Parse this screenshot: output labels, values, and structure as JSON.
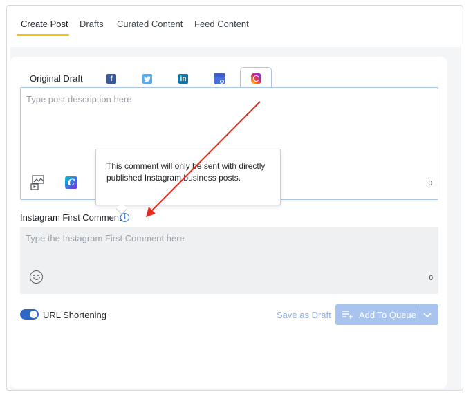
{
  "tabs": [
    {
      "label": "Create Post",
      "active": true
    },
    {
      "label": "Drafts",
      "active": false
    },
    {
      "label": "Curated Content",
      "active": false
    },
    {
      "label": "Feed Content",
      "active": false
    }
  ],
  "networks": {
    "original_label": "Original Draft",
    "icons": [
      "facebook-icon",
      "twitter-icon",
      "linkedin-icon",
      "google-business-icon",
      "instagram-icon"
    ],
    "active": "instagram"
  },
  "description": {
    "placeholder": "Type post description here",
    "count": "0"
  },
  "tooltip": {
    "text": "This comment will only be sent with directly published Instagram business posts."
  },
  "first_comment": {
    "label": "Instagram First Comment",
    "placeholder": "Type the Instagram First Comment here",
    "count": "0"
  },
  "url_shortening": {
    "label": "URL Shortening",
    "enabled": true
  },
  "actions": {
    "save_draft": "Save as Draft",
    "add_to_queue": "Add To Queue"
  },
  "colors": {
    "accent": "#2d68c4",
    "tab_underline": "#f4c20d",
    "annotation_arrow": "#e32b20",
    "queue_button": "#a8c4ee"
  }
}
